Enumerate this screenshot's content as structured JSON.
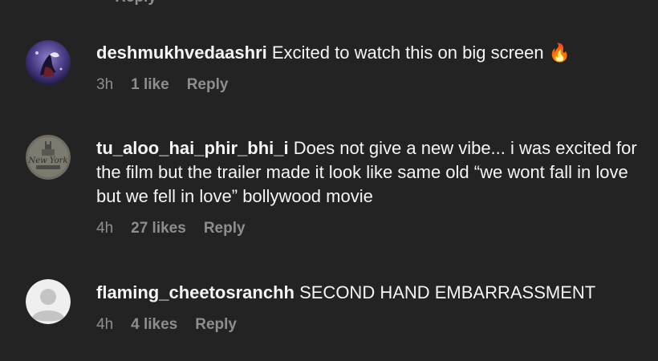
{
  "top_partial": {
    "text": "·  ·  Reply"
  },
  "comments": [
    {
      "username": "deshmukhvedaashri",
      "text": "Excited to watch this on big screen 🔥",
      "time": "3h",
      "likes": "1 like",
      "reply": "Reply",
      "avatar_icon": "illustrated-avatar-icon"
    },
    {
      "username": "tu_aloo_hai_phir_bhi_i",
      "text": "Does not give a new vibe... i was excited for the film but the trailer made it look like same old “we wont fall in love but we fell in love” bollywood movie",
      "time": "4h",
      "likes": "27 likes",
      "reply": "Reply",
      "avatar_icon": "new-york-logo-avatar-icon"
    },
    {
      "username": "flaming_cheetosranchh",
      "text": "SECOND HAND EMBARRASSMENT",
      "time": "4h",
      "likes": "4 likes",
      "reply": "Reply",
      "avatar_icon": "default-user-avatar-icon"
    }
  ]
}
